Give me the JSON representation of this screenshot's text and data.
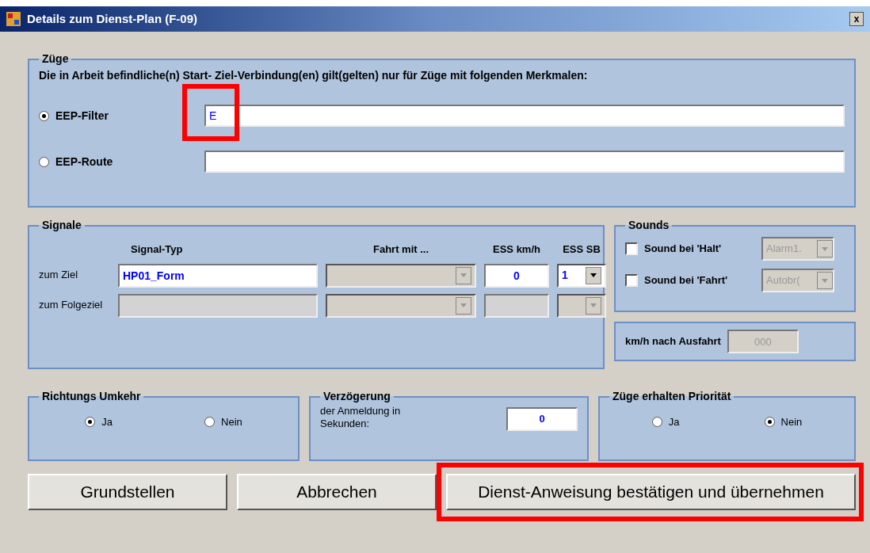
{
  "window": {
    "title": "Details zum Dienst-Plan (F-09)",
    "close": "x"
  },
  "zuege": {
    "legend": "Züge",
    "description": "Die in Arbeit befindliche(n) Start- Ziel-Verbindung(en) gilt(gelten) nur für Züge mit folgenden Merkmalen:",
    "options": [
      {
        "label": "EEP-Filter",
        "selected": true,
        "value": "E",
        "highlighted": true
      },
      {
        "label": "EEP-Route",
        "selected": false,
        "highlighted": false
      }
    ]
  },
  "signale": {
    "legend": "Signale",
    "columns": [
      "Signal-Typ",
      "Fahrt mit ...",
      "ESS km/h",
      "ESS SB"
    ],
    "rows": [
      {
        "label": "zum Ziel",
        "signal_typ": "HP01_Form",
        "disabled": false,
        "ess_kmh": "0",
        "ess_sb": "1"
      },
      {
        "label": "zum Folgeziel",
        "disabled": true
      }
    ]
  },
  "sounds": {
    "legend": "Sounds",
    "items": [
      {
        "label": "Sound bei 'Halt'",
        "checked": false,
        "value": "Alarm1."
      },
      {
        "label": "Sound bei 'Fahrt'",
        "checked": false,
        "value": "Autobr("
      }
    ]
  },
  "ausfahrt": {
    "label": "km/h nach Ausfahrt",
    "value": "000"
  },
  "richtung": {
    "legend": "Richtungs Umkehr",
    "options": [
      {
        "label": "Ja",
        "selected": true
      },
      {
        "label": "Nein",
        "selected": false
      }
    ]
  },
  "verzoegerung": {
    "legend": "Verzögerung",
    "label": "der Anmeldung in Sekunden:",
    "value": "0"
  },
  "prioritaet": {
    "legend": "Züge erhalten Priorität",
    "options": [
      {
        "label": "Ja",
        "selected": false
      },
      {
        "label": "Nein",
        "selected": true
      }
    ]
  },
  "buttons": [
    {
      "label": "Grundstellen",
      "highlighted": false
    },
    {
      "label": "Abbrechen",
      "highlighted": false
    },
    {
      "label": "Dienst-Anweisung bestätigen und übernehmen",
      "highlighted": true
    }
  ]
}
